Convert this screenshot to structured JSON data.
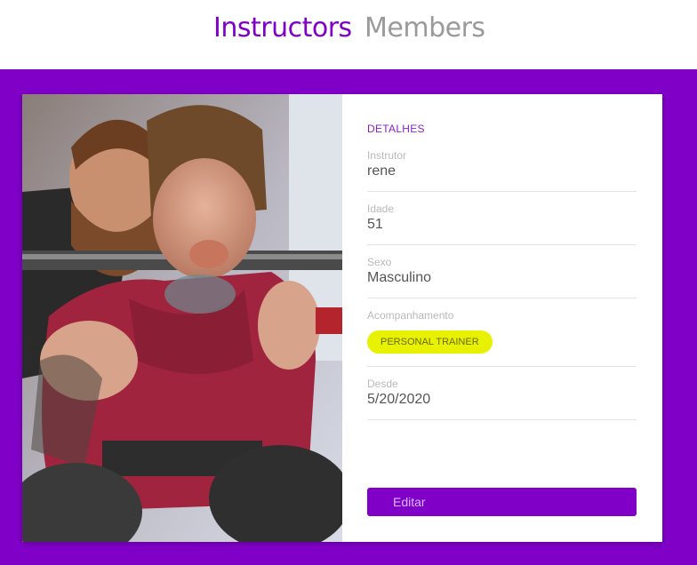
{
  "nav": {
    "instructors_label": "Instructors",
    "members_label": "Members"
  },
  "details": {
    "section_title": "DETALHES",
    "instructor": {
      "label": "Instrutor",
      "value": "rene"
    },
    "age": {
      "label": "Idade",
      "value": "51"
    },
    "sex": {
      "label": "Sexo",
      "value": "Masculino"
    },
    "services": {
      "label": "Acompanhamento",
      "badges": [
        "PERSONAL TRAINER"
      ]
    },
    "since": {
      "label": "Desde",
      "value": "5/20/2020"
    },
    "edit_label": "Editar"
  },
  "colors": {
    "brand": "#8000c8",
    "badge": "#e8f200"
  }
}
